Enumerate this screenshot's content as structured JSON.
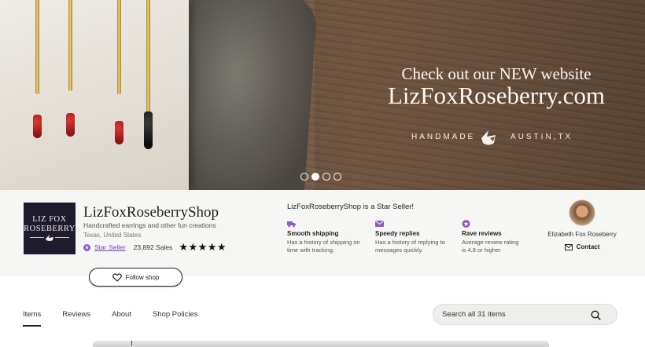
{
  "hero": {
    "line1": "Check out our NEW website",
    "line2": "LizFoxRoseberry.com",
    "tag_left": "HANDMADE",
    "tag_right": "AUSTIN,TX",
    "slide_count": 4,
    "active_slide": 2
  },
  "shop": {
    "logo_line1": "LIZ FOX",
    "logo_line2": "ROSEBERRY",
    "name": "LizFoxRoseberryShop",
    "tagline": "Handcrafted earrings and other fun creations",
    "location": "Texas, United States",
    "star_seller_label": "Star Seller",
    "sales": "23,892 Sales",
    "rating": 5,
    "stars": "★★★★★",
    "follow_label": "Follow shop"
  },
  "star_seller": {
    "title": "LizFoxRoseberryShop is a Star Seller!",
    "features": [
      {
        "icon": "truck-icon",
        "title": "Smooth shipping",
        "desc1": "Has a history of shipping on",
        "desc2": "time with tracking."
      },
      {
        "icon": "envelope-icon",
        "title": "Speedy replies",
        "desc1": "Has a history of replying to",
        "desc2": "messages quickly."
      },
      {
        "icon": "star-badge-icon",
        "title": "Rave reviews",
        "desc1": "Average review rating",
        "desc2": "is 4.8 or higher"
      }
    ]
  },
  "owner": {
    "name": "Elizabeth Fox Roseberry",
    "contact_label": "Contact"
  },
  "tabs": [
    {
      "label": "Items",
      "active": true
    },
    {
      "label": "Reviews",
      "active": false
    },
    {
      "label": "About",
      "active": false
    },
    {
      "label": "Shop Policies",
      "active": false
    }
  ],
  "search": {
    "placeholder": "Search all 31 items"
  },
  "colors": {
    "star_seller_purple": "#7b43b8",
    "logo_bg": "#1f1b2e",
    "info_bg": "#f6f6f4"
  }
}
